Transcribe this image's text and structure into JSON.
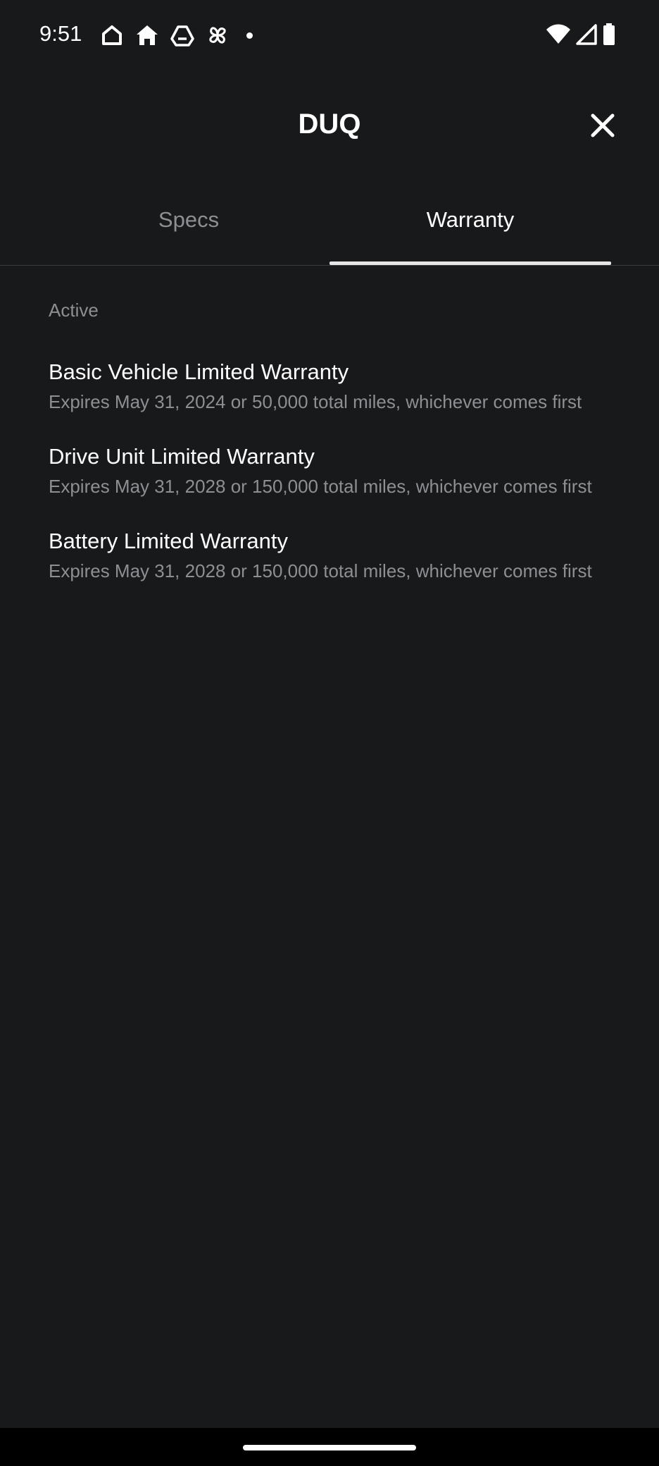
{
  "status_bar": {
    "time": "9:51",
    "left_icons": [
      "home-outline-icon",
      "home-filled-icon",
      "drive-icon",
      "pinwheel-icon"
    ],
    "right_icons": [
      "wifi-icon",
      "cell-signal-icon",
      "battery-icon"
    ]
  },
  "header": {
    "title": "DUQ",
    "close_icon": "close-icon"
  },
  "tabs": [
    {
      "label": "Specs",
      "active": false
    },
    {
      "label": "Warranty",
      "active": true
    }
  ],
  "warranty": {
    "section_label": "Active",
    "items": [
      {
        "title": "Basic Vehicle Limited Warranty",
        "description": "Expires May 31, 2024 or 50,000 total miles, whichever comes first"
      },
      {
        "title": "Drive Unit Limited Warranty",
        "description": "Expires May 31, 2028 or 150,000 total miles, whichever comes first"
      },
      {
        "title": "Battery Limited Warranty",
        "description": "Expires May 31, 2028 or 150,000 total miles, whichever comes first"
      }
    ]
  },
  "colors": {
    "background": "#18191b",
    "text_primary": "#ffffff",
    "text_secondary": "#8e8f93",
    "divider": "#3a3b3d",
    "tab_indicator": "#e6e6e6"
  }
}
